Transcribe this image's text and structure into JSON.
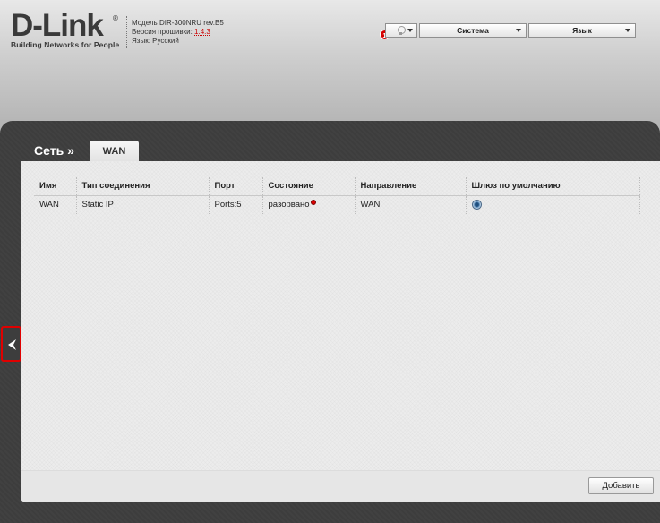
{
  "header": {
    "logo_text": "D-Link",
    "logo_reg": "®",
    "logo_tagline": "Building Networks for People",
    "model_line": "Модель DIR-300NRU rev.B5",
    "firmware_label": "Версия прошивки: ",
    "firmware_version": "1.4.3",
    "language_line": "Язык: Русский"
  },
  "topbar": {
    "notification_count": "1",
    "bulb_icon": "lightbulb-icon",
    "system_label": "Система",
    "language_label": "Язык"
  },
  "breadcrumb": {
    "section": "Сеть »",
    "tab": "WAN"
  },
  "table": {
    "headers": [
      "Имя",
      "Тип соединения",
      "Порт",
      "Состояние",
      "Направление",
      "Шлюз по умолчанию"
    ],
    "rows": [
      {
        "name": "WAN",
        "type": "Static IP",
        "port": "Ports:5",
        "state": "разорвано",
        "direction": "WAN",
        "default_gateway": true
      }
    ]
  },
  "actions": {
    "add_label": "Добавить"
  },
  "colors": {
    "frame": "#3d3d3d",
    "status_disconnected": "#dd0000",
    "highlight_border": "#e00000"
  }
}
